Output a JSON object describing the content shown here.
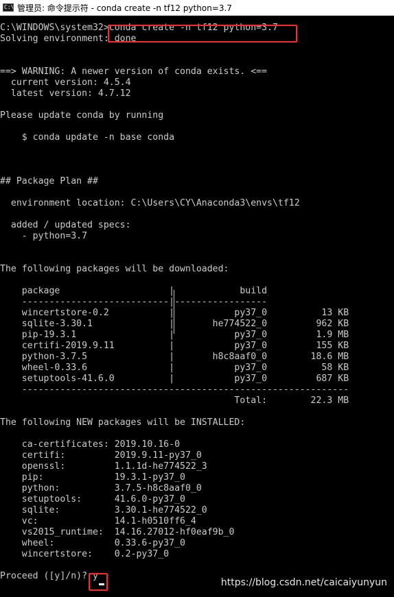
{
  "window": {
    "title": "管理员: 命令提示符 - conda  create -n tf12 python=3.7",
    "icon": "cmd-icon",
    "icon_text": "C:\\"
  },
  "console": {
    "lines": [
      "C:\\WINDOWS\\system32>conda create -n tf12 python=3.7",
      "Solving environment: done",
      "",
      "",
      "==> WARNING: A newer version of conda exists. <==",
      "  current version: 4.5.4",
      "  latest version: 4.7.12",
      "",
      "Please update conda by running",
      "",
      "    $ conda update -n base conda",
      "",
      "",
      "",
      "## Package Plan ##",
      "",
      "  environment location: C:\\Users\\CY\\Anaconda3\\envs\\tf12",
      "",
      "  added / updated specs:",
      "    - python=3.7",
      "",
      "",
      "The following packages will be downloaded:",
      "",
      "    package                    |            build",
      "    ---------------------------|-----------------",
      "    wincertstore-0.2           |           py37_0          13 KB",
      "    sqlite-3.30.1              |       he774522_0         962 KB",
      "    pip-19.3.1                 |           py37_0         1.9 MB",
      "    certifi-2019.9.11          |           py37_0         155 KB",
      "    python-3.7.5               |       h8c8aaf0_0        18.6 MB",
      "    wheel-0.33.6               |           py37_0          58 KB",
      "    setuptools-41.6.0          |           py37_0         687 KB",
      "    ------------------------------------------------------------",
      "                                           Total:        22.3 MB",
      "",
      "The following NEW packages will be INSTALLED:",
      "",
      "    ca-certificates: 2019.10.16-0",
      "    certifi:         2019.9.11-py37_0",
      "    openssl:         1.1.1d-he774522_3",
      "    pip:             19.3.1-py37_0",
      "    python:          3.7.5-h8c8aaf0_0",
      "    setuptools:      41.6.0-py37_0",
      "    sqlite:          3.30.1-he774522_0",
      "    vc:              14.1-h0510ff6_4",
      "    vs2015_runtime:  14.16.27012-hf0eaf9b_0",
      "    wheel:           0.33.6-py37_0",
      "    wincertstore:    0.2-py37_0",
      "",
      "Proceed ([y]/n)? y"
    ]
  },
  "watermark": "https://blog.csdn.net/caicaiyunyun",
  "colors": {
    "background": "#000000",
    "text": "#cccccc",
    "highlight": "#ff2a2a"
  }
}
